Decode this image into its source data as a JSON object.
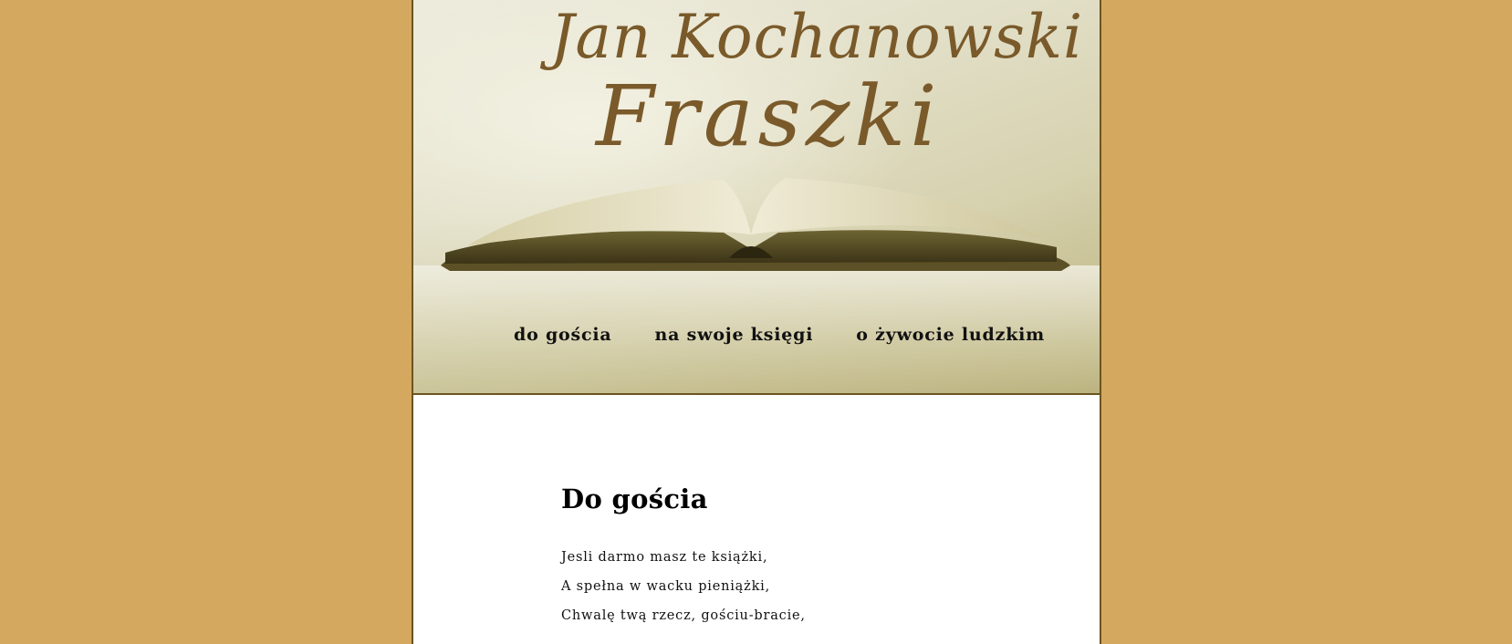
{
  "header": {
    "author": "Jan Kochanowski",
    "work": "Fraszki"
  },
  "nav": {
    "items": [
      {
        "label": "do gościa"
      },
      {
        "label": "na swoje księgi"
      },
      {
        "label": "o żywocie ludzkim"
      }
    ]
  },
  "content": {
    "title": "Do gościa",
    "lines": [
      "Jesli darmo masz te książki,",
      "A spełna w wacku pieniążki,",
      "Chwalę twą rzecz, gościu-bracie,"
    ]
  },
  "colors": {
    "background": "#d4a85e",
    "title_brown": "#7a5a2a",
    "border": "#6b5420"
  }
}
